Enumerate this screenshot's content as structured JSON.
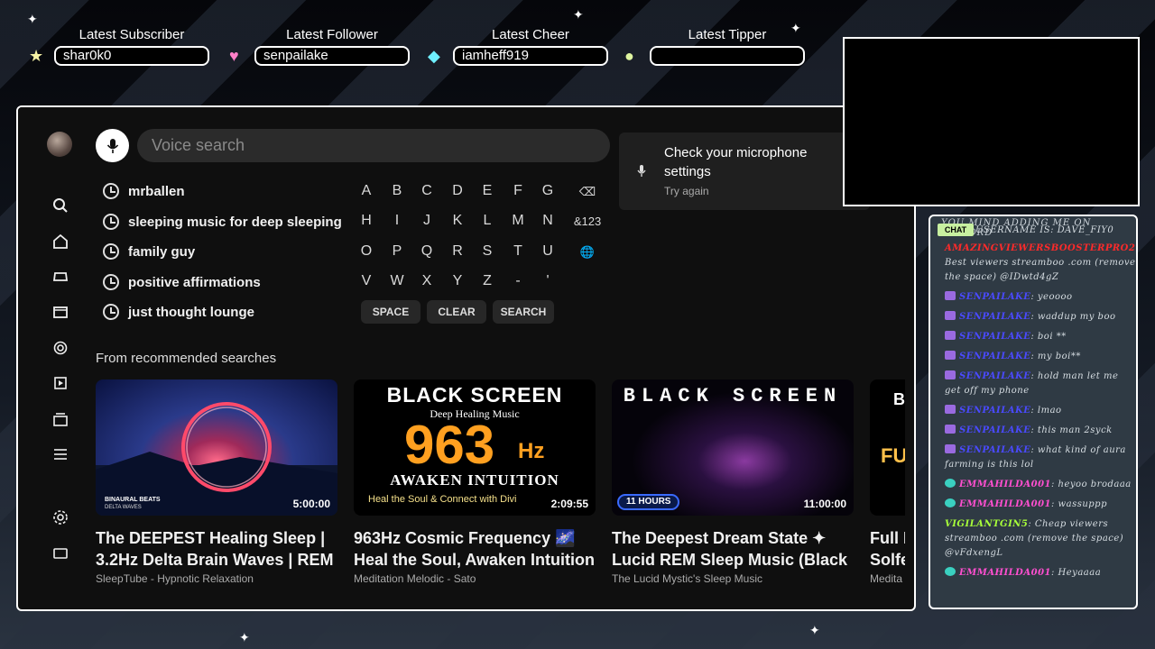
{
  "alerts": [
    {
      "title": "Latest Subscriber",
      "value": "shar0k0",
      "icon": "star-icon",
      "color": "#f7f3a6",
      "glyph": "★"
    },
    {
      "title": "Latest Follower",
      "value": "senpailake",
      "icon": "heart-icon",
      "color": "#ff7fc8",
      "glyph": "♥"
    },
    {
      "title": "Latest Cheer",
      "value": "iamheff919",
      "icon": "diamond-icon",
      "color": "#6ff0ff",
      "glyph": "◆"
    },
    {
      "title": "Latest Tipper",
      "value": "",
      "icon": "coin-icon",
      "color": "#dff5a0",
      "glyph": "●"
    }
  ],
  "youtube": {
    "search_placeholder": "Voice search",
    "history": [
      "mrballen",
      "sleeping music for deep sleeping",
      "family guy",
      "positive affirmations",
      "just thought lounge"
    ],
    "keyboard": {
      "rows": [
        [
          "A",
          "B",
          "C",
          "D",
          "E",
          "F",
          "G",
          "⌫"
        ],
        [
          "H",
          "I",
          "J",
          "K",
          "L",
          "M",
          "N",
          "&123"
        ],
        [
          "O",
          "P",
          "Q",
          "R",
          "S",
          "T",
          "U",
          "🌐"
        ],
        [
          "V",
          "W",
          "X",
          "Y",
          "Z",
          "-",
          "'"
        ]
      ],
      "space": "SPACE",
      "clear": "CLEAR",
      "search": "SEARCH"
    },
    "mic_message": "Check your microphone settings",
    "mic_retry": "Try again",
    "recommended_title": "From recommended searches",
    "videos": [
      {
        "title": "The DEEPEST Healing Sleep |",
        "title2": "3.2Hz Delta Brain Waves | REM",
        "channel": "SleepTube - Hypnotic Relaxation",
        "duration": "5:00:00",
        "logo": "BINAURAL BEATS",
        "logo2": "DELTA WAVES"
      },
      {
        "title": "963Hz Cosmic Frequency 🌌",
        "title2": "Heal the Soul, Awaken Intuition",
        "channel": "Meditation Melodic - Sato",
        "duration": "2:09:55",
        "t1": "BLACK SCREEN",
        "t2": "Deep Healing Music",
        "t3": "963",
        "t3b": "Hz",
        "t4": "AWAKEN INTUITION",
        "t5": "Heal the Soul & Connect with Divi"
      },
      {
        "title": "The Deepest Dream State ✦",
        "title2": "Lucid REM Sleep Music (Black",
        "channel": "The Lucid Mystic's Sleep Music",
        "duration": "11:00:00",
        "t1": "BLACK SCREEN",
        "badge": "11 HOURS"
      },
      {
        "title": "Full I",
        "title2": "Solfe",
        "channel": "Medita",
        "t1": "B",
        "t2": "FU"
      }
    ]
  },
  "chat": {
    "header_line": "YOU MIND ADDING ME ON DISCORD",
    "badge": "CHAT",
    "lines": [
      {
        "user": "",
        "text": "USERNAME IS: DAVE_FIY0",
        "color": "#cfd6dc"
      },
      {
        "user": "AMAZINGVIEWERSBOOSTERPRO2",
        "text": "Best viewers streamboo .com (remove the space) @IDwtd4gZ",
        "color": "#ff2a2a"
      },
      {
        "user": "senpailake",
        "text": "yeoooo",
        "color": "#4a4aff"
      },
      {
        "user": "senpailake",
        "text": "waddup my boo",
        "color": "#4a4aff"
      },
      {
        "user": "senpailake",
        "text": "boi **",
        "color": "#4a4aff"
      },
      {
        "user": "senpailake",
        "text": "my boi**",
        "color": "#4a4aff"
      },
      {
        "user": "senpailake",
        "text": "hold man let me get off my phone",
        "color": "#4a4aff"
      },
      {
        "user": "senpailake",
        "text": "lmao",
        "color": "#4a4aff"
      },
      {
        "user": "senpailake",
        "text": "this man 2syck",
        "color": "#4a4aff"
      },
      {
        "user": "senpailake",
        "text": "what kind of aura farming is this lol",
        "color": "#4a4aff"
      },
      {
        "user": "emmahilda001",
        "text": "heyoo brodaaa",
        "color": "#ff4fd0"
      },
      {
        "user": "emmahilda001",
        "text": "wassuppp",
        "color": "#ff4fd0"
      },
      {
        "user": "vigilantgin5",
        "text": "Cheap viewers streamboo .com (remove the space) @vFdxengL",
        "color": "#a8ff3a"
      },
      {
        "user": "emmahilda001",
        "text": "Heyaaaa",
        "color": "#ff4fd0"
      }
    ]
  }
}
